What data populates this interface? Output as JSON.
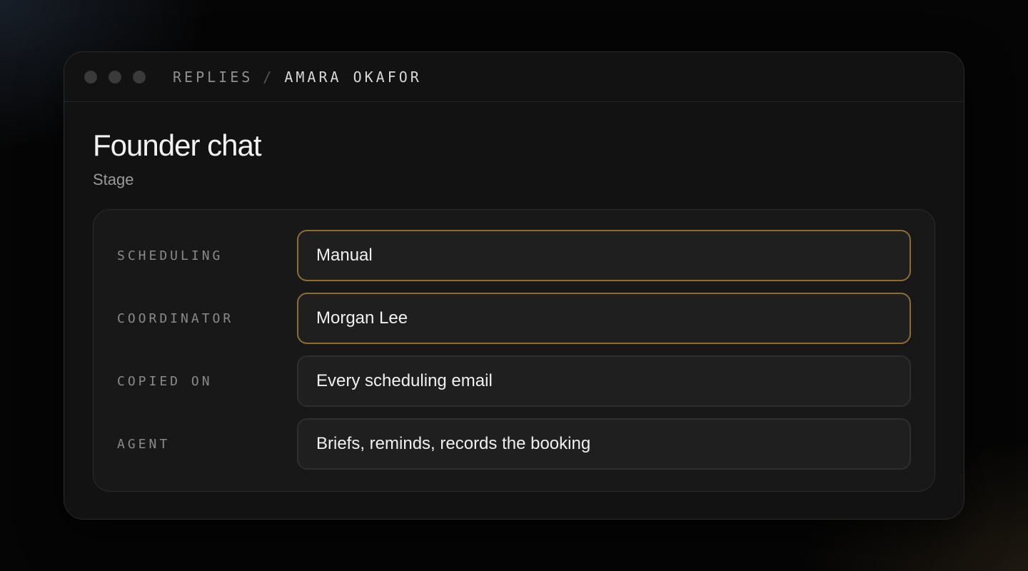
{
  "breadcrumb": {
    "parent": "REPLIES",
    "separator": "/",
    "current": "AMARA OKAFOR"
  },
  "header": {
    "title": "Founder chat",
    "subtitle": "Stage"
  },
  "fields": [
    {
      "label": "SCHEDULING",
      "value": "Manual",
      "highlighted": true
    },
    {
      "label": "COORDINATOR",
      "value": "Morgan Lee",
      "highlighted": true
    },
    {
      "label": "COPIED ON",
      "value": "Every scheduling email",
      "highlighted": false
    },
    {
      "label": "AGENT",
      "value": "Briefs, reminds, records the booking",
      "highlighted": false
    }
  ],
  "colors": {
    "accent_border": "#8a6e3a",
    "background": "#050505",
    "window": "#121212"
  }
}
